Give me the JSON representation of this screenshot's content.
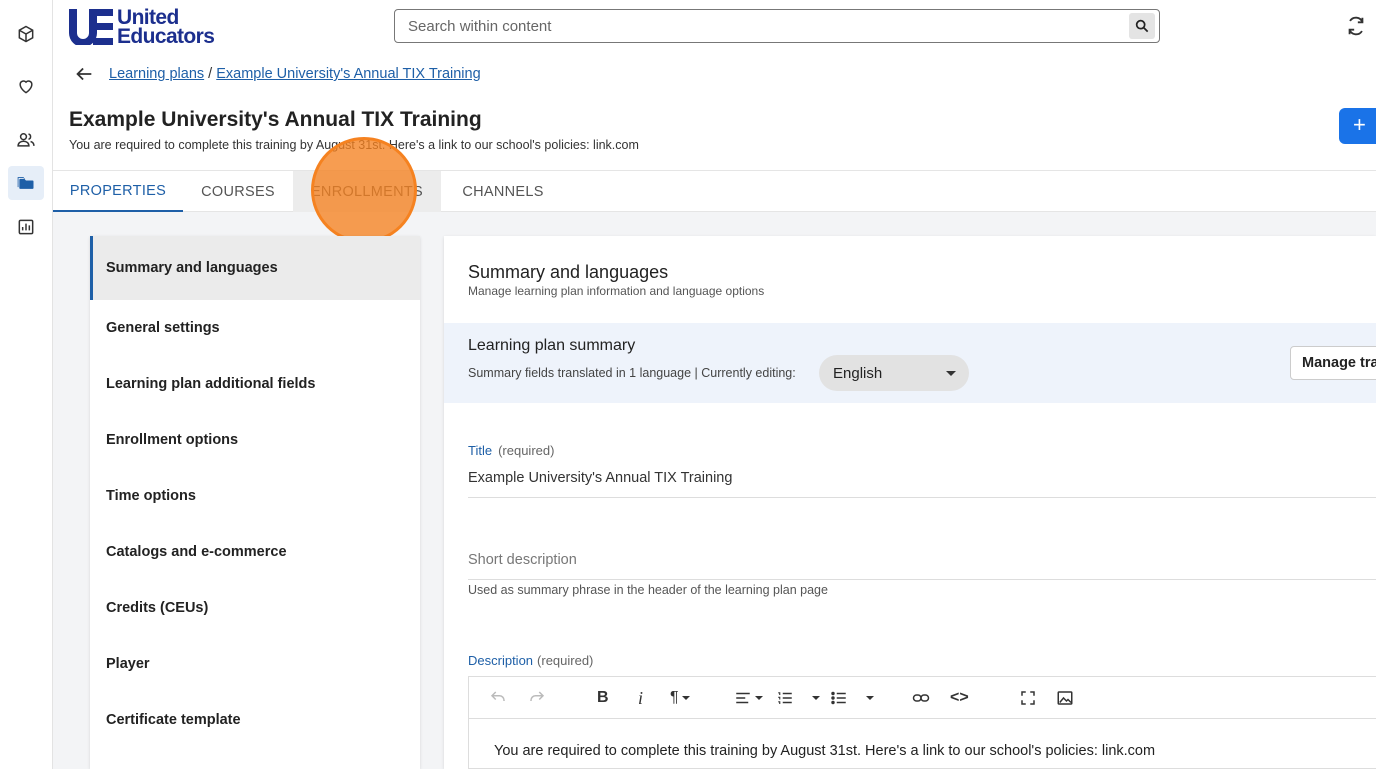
{
  "brand": {
    "line1": "United",
    "line2": "Educators"
  },
  "search": {
    "placeholder": "Search within content"
  },
  "breadcrumb": {
    "parent": "Learning plans",
    "separator": "/",
    "current": "Example University's Annual TIX Training"
  },
  "page": {
    "title": "Example University's Annual TIX Training",
    "subtitle": "You are required to complete this training by August 31st.  Here's a link to our school's policies: link.com",
    "add_label": "+"
  },
  "tabs": [
    {
      "label": "PROPERTIES"
    },
    {
      "label": "COURSES"
    },
    {
      "label": "ENROLLMENTS"
    },
    {
      "label": "CHANNELS"
    }
  ],
  "side_menu": [
    {
      "label": "Summary and languages"
    },
    {
      "label": "General settings"
    },
    {
      "label": "Learning plan additional fields"
    },
    {
      "label": "Enrollment options"
    },
    {
      "label": "Time options"
    },
    {
      "label": "Catalogs and e-commerce"
    },
    {
      "label": "Credits (CEUs)"
    },
    {
      "label": "Player"
    },
    {
      "label": "Certificate template"
    }
  ],
  "panel": {
    "title": "Summary and languages",
    "subtitle": "Manage learning plan information and language options",
    "summary_title": "Learning plan summary",
    "summary_meta": "Summary fields translated in 1 language | Currently editing:",
    "language": "English",
    "manage_label": "Manage translations",
    "title_label": "Title",
    "required": "(required)",
    "title_value": "Example University's Annual TIX Training",
    "short_desc_placeholder": "Short description",
    "short_desc_help": "Used as summary phrase in the header of the learning plan page",
    "description_label": "Description",
    "description_value": "You are required to complete this training by August 31st.  Here's a link to our school's policies: link.com",
    "toolbar": {
      "bold": "B",
      "italic": "i",
      "paragraph": "¶",
      "code": "<>"
    }
  },
  "colors": {
    "accent": "#1e5fa7",
    "brand": "#1c2f8e",
    "primary_button": "#1a73e8",
    "click_marker": "#f58220"
  }
}
